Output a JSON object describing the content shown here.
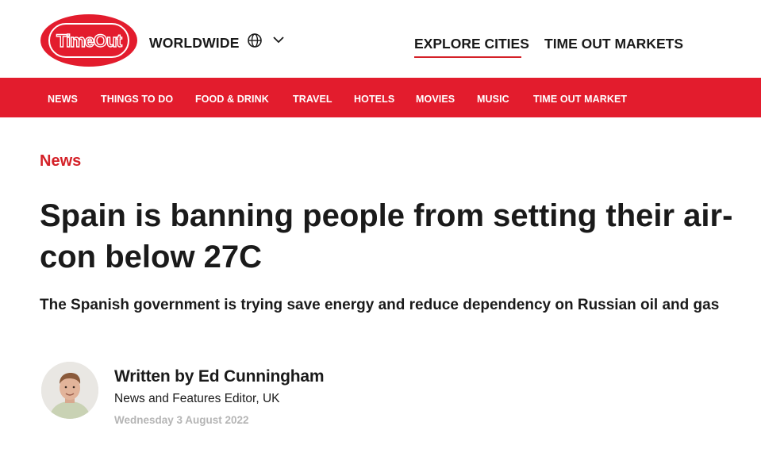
{
  "header": {
    "logo_text": "TimeOut",
    "region": "WORLDWIDE",
    "globe_icon": "globe-icon",
    "chevron_icon": "chevron-down-icon",
    "explore_cities": "EXPLORE CITIES",
    "time_out_markets": "TIME OUT MARKETS"
  },
  "nav": {
    "items": [
      "NEWS",
      "THINGS TO DO",
      "FOOD & DRINK",
      "TRAVEL",
      "HOTELS",
      "MOVIES",
      "MUSIC",
      "TIME OUT MARKET"
    ]
  },
  "article": {
    "category": "News",
    "headline": "Spain is banning people from setting their air-con below 27C",
    "standfirst": "The Spanish government is trying save energy and reduce dependency on Russian oil and gas",
    "author_byline": "Written by Ed Cunningham",
    "author_role": "News and Features Editor, UK",
    "date": "Wednesday 3 August 2022"
  },
  "colors": {
    "brand_red": "#e31c2d",
    "text": "#1a1a1a",
    "muted": "#b5b5b5"
  }
}
